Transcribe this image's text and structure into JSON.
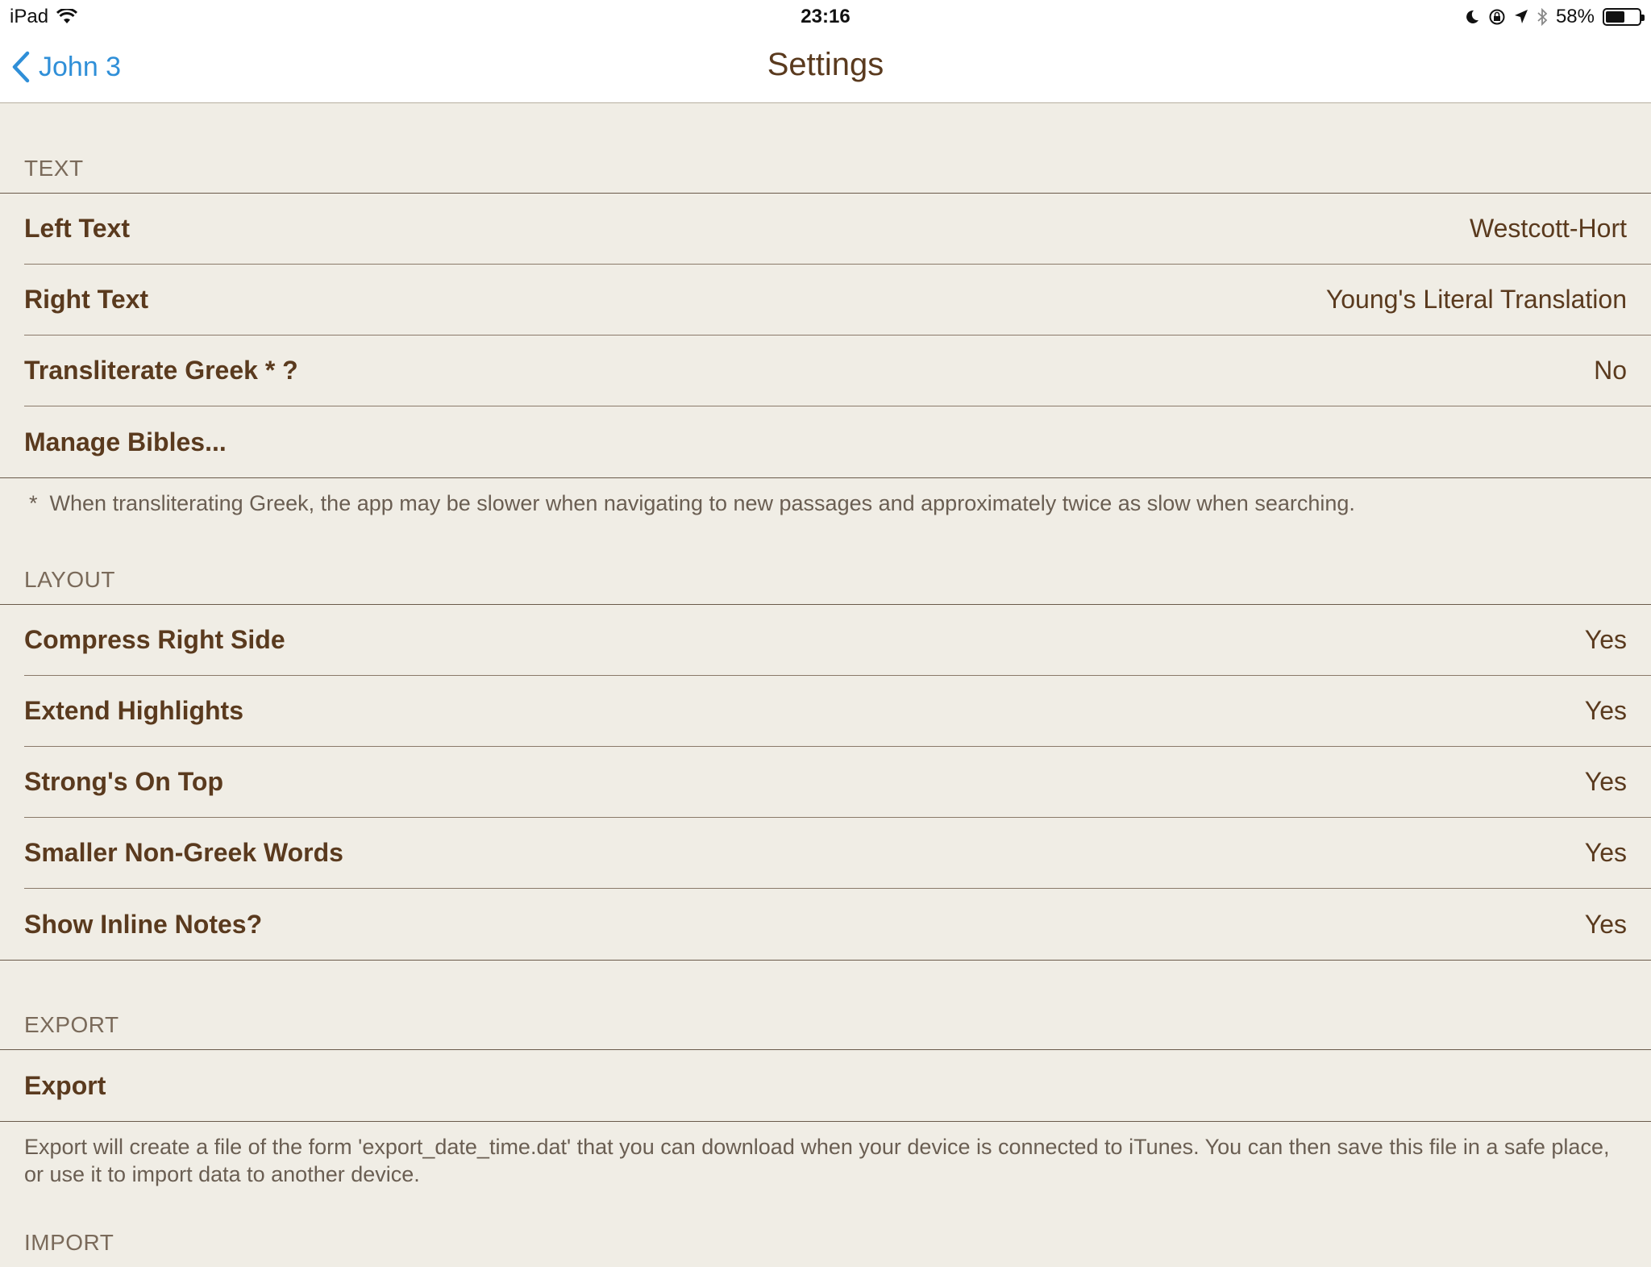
{
  "status_bar": {
    "device": "iPad",
    "time": "23:16",
    "battery": "58%",
    "battery_level": 0.58
  },
  "nav": {
    "back_label": "John 3",
    "title": "Settings"
  },
  "sections": {
    "text": {
      "header": "TEXT",
      "rows": [
        {
          "label": "Left Text",
          "value": "Westcott-Hort"
        },
        {
          "label": "Right Text",
          "value": "Young's Literal Translation"
        },
        {
          "label": "Transliterate Greek * ?",
          "value": "No"
        },
        {
          "label": "Manage Bibles...",
          "value": ""
        }
      ],
      "footer_marker": "*",
      "footer": "When transliterating Greek, the app may be slower when navigating to new passages and approximately twice as slow when searching."
    },
    "layout": {
      "header": "LAYOUT",
      "rows": [
        {
          "label": "Compress Right Side",
          "value": "Yes"
        },
        {
          "label": "Extend Highlights",
          "value": "Yes"
        },
        {
          "label": "Strong's On Top",
          "value": "Yes"
        },
        {
          "label": "Smaller Non-Greek Words",
          "value": "Yes"
        },
        {
          "label": "Show Inline Notes?",
          "value": "Yes"
        }
      ]
    },
    "export": {
      "header": "EXPORT",
      "rows": [
        {
          "label": "Export",
          "value": ""
        }
      ],
      "footer": "Export will create a file of the form 'export_date_time.dat' that you can download when your device is connected to iTunes. You can then save this file in a safe place, or use it to import data to another device."
    },
    "import": {
      "header": "IMPORT"
    }
  }
}
